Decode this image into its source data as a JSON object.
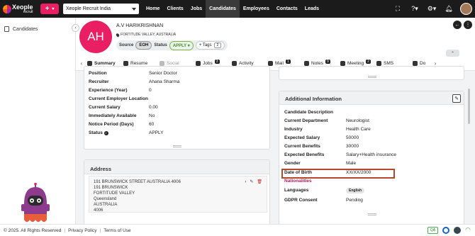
{
  "topbar": {
    "logo_text": "Xeople",
    "logo_sub": "recruit",
    "company": "Xeople Recruit India",
    "nav": [
      "Home",
      "Clients",
      "Jobs",
      "Candidates",
      "Employees",
      "Contacts",
      "Leads"
    ],
    "active_nav": "Candidates",
    "help_glyph": "?"
  },
  "sidebar": {
    "items": [
      {
        "label": "Candidates",
        "icon": "document-icon"
      }
    ]
  },
  "candidate": {
    "initials": "AH",
    "name": "A.V HARIKRISHNAN",
    "location": "FORTITUDE VALLEY, AUSTRALIA",
    "source_label": "Source",
    "source_value": "EOH",
    "status_label": "Status",
    "status_value": "APPLY",
    "tags_label": "+ Tags",
    "tags_count": "2"
  },
  "tabs": [
    {
      "label": "Summary",
      "badge": ""
    },
    {
      "label": "Resume",
      "badge": ""
    },
    {
      "label": "Social",
      "badge": ""
    },
    {
      "label": "Jobs",
      "badge": "3"
    },
    {
      "label": "Activity",
      "badge": ""
    },
    {
      "label": "Mail",
      "badge": "1"
    },
    {
      "label": "Notes",
      "badge": "9"
    },
    {
      "label": "Meeting",
      "badge": "2"
    },
    {
      "label": "SMS",
      "badge": ""
    },
    {
      "label": "Do",
      "badge": ""
    }
  ],
  "details": [
    {
      "label": "Position",
      "value": "Senior Doctor"
    },
    {
      "label": "Recruiter",
      "value": "Ahana Sharma"
    },
    {
      "label": "Experience (Year)",
      "value": "0"
    },
    {
      "label": "Current Employer Location",
      "value": ""
    },
    {
      "label": "Current Salary",
      "value": "0.00"
    },
    {
      "label": "Immediately Available",
      "value": "No"
    },
    {
      "label": "Notice Period (Days)",
      "value": "60"
    },
    {
      "label": "Status",
      "value": "APPLY"
    }
  ],
  "address": {
    "title": "Address",
    "lines": [
      "191 BRUNSWICK STREET AUSTRALIA 4006",
      "191 BRUNSWICK",
      "FORTITUDE VALLEY",
      "Queensland",
      "AUSTRALIA",
      "4006"
    ]
  },
  "additional": {
    "title": "Additional Information",
    "rows": [
      {
        "label": "Candidate Description",
        "value": ""
      },
      {
        "label": "Current Department",
        "value": "Neurologist"
      },
      {
        "label": "Industry",
        "value": "Health Care"
      },
      {
        "label": "Expected Salary",
        "value": "50000"
      },
      {
        "label": "Current Benefits",
        "value": "30000"
      },
      {
        "label": "Expected Benefits",
        "value": "Salary+Health insurance"
      },
      {
        "label": "Gender",
        "value": "Male"
      },
      {
        "label": "Date of Birth",
        "value": "XX/XX/2000"
      },
      {
        "label": "Nationalities",
        "value": ""
      },
      {
        "label": "Languages",
        "value": "English"
      },
      {
        "label": "GDPR Consent",
        "value": "Pending"
      }
    ]
  },
  "footer": {
    "copyright": "© 2025. All Rights Reserved",
    "privacy": "Privacy Policy",
    "terms": "Terms of Use",
    "qa": "QA"
  },
  "colors": {
    "accent": "#e91e63",
    "highlight": "#b5472a"
  }
}
